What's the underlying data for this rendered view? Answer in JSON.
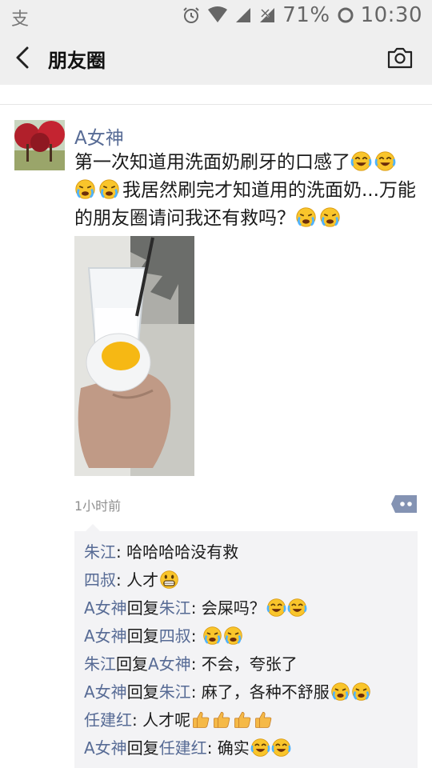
{
  "status_bar": {
    "battery": "71%",
    "time": "10:30"
  },
  "header": {
    "title": "朋友圈"
  },
  "post": {
    "author": "A女神",
    "text_part1": "第一次知道用洗面奶刷牙的口感了",
    "text_part2": "我居然刷完才知道用的洗面奶...万能的朋友圈请问我还有救吗？",
    "time": "1小时前"
  },
  "comments": [
    {
      "from": "朱江",
      "sep": ": ",
      "text": "哈哈哈哈没有救"
    },
    {
      "from": "四叔",
      "sep": ": ",
      "text": "人才"
    },
    {
      "from": "A女神",
      "reply_word": "回复",
      "to": "朱江",
      "sep": ": ",
      "text": "会屎吗？"
    },
    {
      "from": "A女神",
      "reply_word": "回复",
      "to": "四叔",
      "sep": ": ",
      "text": ""
    },
    {
      "from": "朱江",
      "reply_word": "回复",
      "to": "A女神",
      "sep": ": ",
      "text": "不会，夸张了"
    },
    {
      "from": "A女神",
      "reply_word": "回复",
      "to": "朱江",
      "sep": ": ",
      "text": "麻了，各种不舒服"
    },
    {
      "from": "任建红",
      "sep": ": ",
      "text": "人才呢"
    },
    {
      "from": "A女神",
      "reply_word": "回复",
      "to": "任建红",
      "sep": ": ",
      "text": "确实"
    }
  ],
  "icons": {
    "emoji_tears_of_joy": "face-with-tears-of-joy-icon",
    "emoji_crying": "loudly-crying-face-icon",
    "emoji_grin": "grinning-face-icon",
    "emoji_thumbs_up": "thumbs-up-icon"
  },
  "colors": {
    "name_link": "#576b95",
    "header_bg": "#efefef",
    "comment_bg": "#f3f3f5"
  }
}
